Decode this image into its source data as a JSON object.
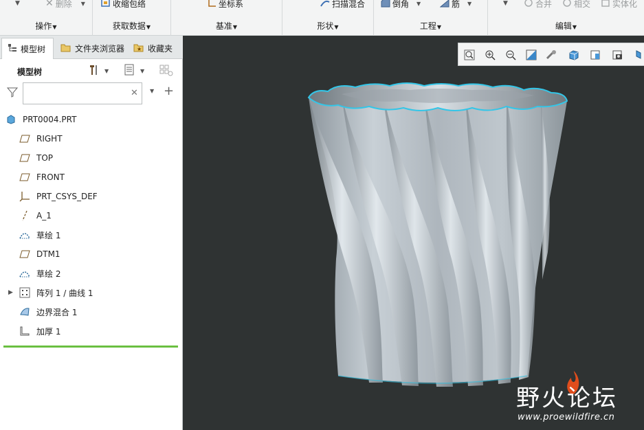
{
  "ribbon": {
    "groups": [
      {
        "label": "操作",
        "tools": [
          {
            "label": "删除"
          }
        ]
      },
      {
        "label": "获取数据",
        "tools": [
          {
            "label": "收缩包络"
          }
        ]
      },
      {
        "label": "基准",
        "tools": [
          {
            "label": "坐标系"
          }
        ]
      },
      {
        "label": "形状",
        "tools": [
          {
            "label": "扫描混合"
          }
        ]
      },
      {
        "label": "工程",
        "tools": [
          {
            "label": "倒角"
          },
          {
            "label": "筋"
          }
        ]
      },
      {
        "label": "编辑",
        "tools": [
          {
            "label": "合并"
          },
          {
            "label": "相交"
          },
          {
            "label": "实体化"
          }
        ]
      }
    ]
  },
  "left_panel": {
    "tabs": [
      {
        "label": "模型树",
        "icon": "model-tree-icon"
      },
      {
        "label": "文件夹浏览器",
        "icon": "folder-browser-icon"
      },
      {
        "label": "收藏夹",
        "icon": "favorites-icon"
      }
    ],
    "tree_title": "模型树",
    "search": {
      "value": "",
      "placeholder": ""
    },
    "tree": {
      "root": "PRT0004.PRT",
      "items": [
        {
          "label": "RIGHT",
          "icon": "datum-plane-icon"
        },
        {
          "label": "TOP",
          "icon": "datum-plane-icon"
        },
        {
          "label": "FRONT",
          "icon": "datum-plane-icon"
        },
        {
          "label": "PRT_CSYS_DEF",
          "icon": "coordinate-system-icon"
        },
        {
          "label": "A_1",
          "icon": "datum-axis-icon"
        },
        {
          "label": "草绘 1",
          "icon": "sketch-icon"
        },
        {
          "label": "DTM1",
          "icon": "datum-plane-icon"
        },
        {
          "label": "草绘 2",
          "icon": "sketch-icon"
        },
        {
          "label": "阵列 1 / 曲线 1",
          "icon": "pattern-icon"
        },
        {
          "label": "边界混合 1",
          "icon": "boundary-blend-icon"
        },
        {
          "label": "加厚 1",
          "icon": "thicken-icon"
        }
      ]
    }
  },
  "viewport": {
    "toolbar": [
      {
        "name": "refit-icon"
      },
      {
        "name": "zoom-in-icon"
      },
      {
        "name": "zoom-out-icon"
      },
      {
        "name": "repaint-icon"
      },
      {
        "name": "spin-center-icon"
      },
      {
        "name": "display-style-icon"
      },
      {
        "name": "saved-orientations-icon"
      },
      {
        "name": "view-manager-icon"
      },
      {
        "name": "datum-display-icon"
      }
    ]
  },
  "watermark": {
    "title": "野火论坛",
    "url": "www.proewildfire.cn"
  },
  "colors": {
    "viewport_bg": "#2f3333",
    "model_body": "#b9c1c7",
    "model_edge": "#33c6e8",
    "insert_bar": "#6abf40",
    "watermark_flame": "#e04d1c"
  }
}
